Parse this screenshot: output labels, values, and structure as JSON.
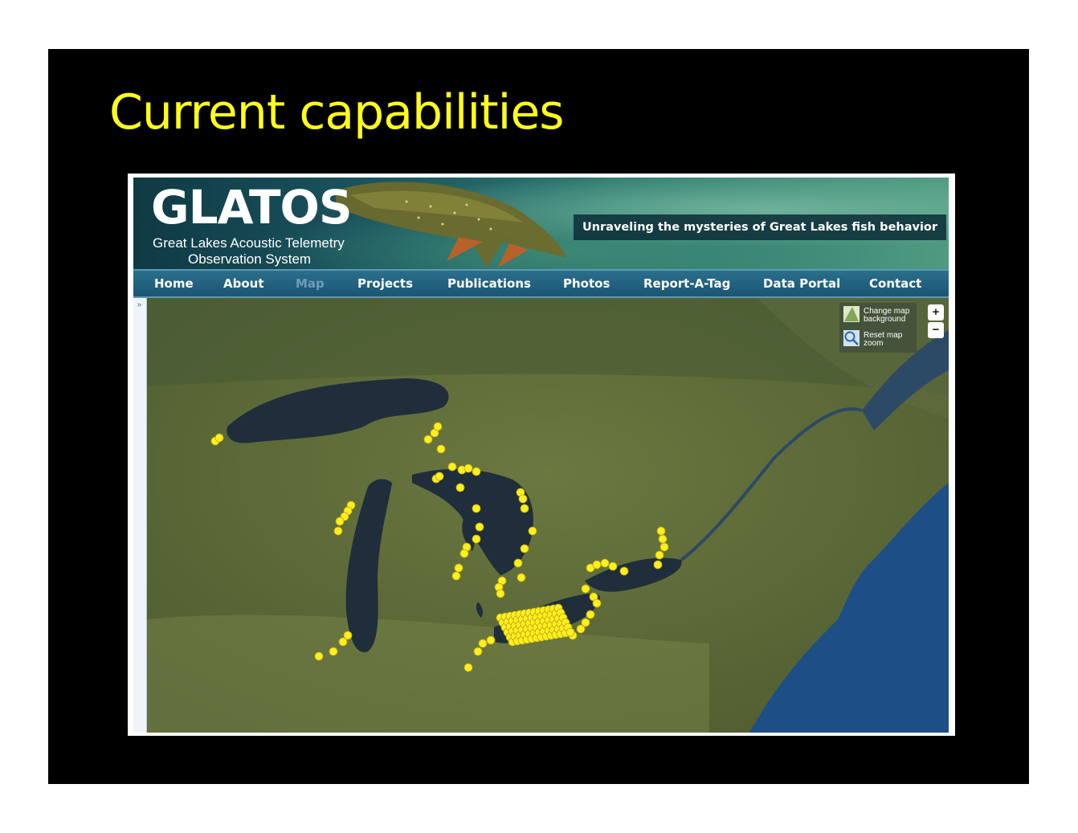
{
  "slide": {
    "title": "Current capabilities"
  },
  "header": {
    "logo_word": "GLATOS",
    "logo_line1": "Great Lakes Acoustic Telemetry",
    "logo_line2": "Observation System",
    "tagline": "Unraveling the mysteries of Great Lakes fish behavior"
  },
  "nav": {
    "items": [
      {
        "label": "Home"
      },
      {
        "label": "About"
      },
      {
        "label": "Map",
        "active": true
      },
      {
        "label": "Projects"
      },
      {
        "label": "Publications"
      },
      {
        "label": "Photos"
      },
      {
        "label": "Report-A-Tag"
      },
      {
        "label": "Data Portal"
      },
      {
        "label": "Contact"
      }
    ]
  },
  "sidebar": {
    "toggle_label": "»"
  },
  "map": {
    "change_background_label": "Change map background",
    "reset_zoom_label": "Reset map zoom",
    "zoom_in_label": "+",
    "zoom_out_label": "−",
    "receiver_color": "#ffef1a",
    "land_color": "#5d6b3a",
    "water_color": "#1f2e3a"
  }
}
